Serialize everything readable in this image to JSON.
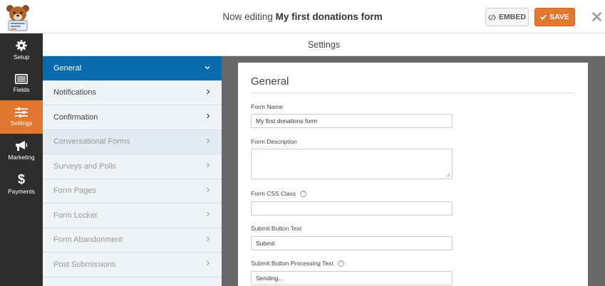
{
  "header": {
    "title_prefix": "Now editing",
    "form_name": "My first donations form",
    "embed_label": "EMBED",
    "save_label": "SAVE",
    "logo_icon": "wpforms-bear-logo-icon",
    "close_icon": "close-icon"
  },
  "sidebar": {
    "items": [
      {
        "label": "Setup",
        "icon": "gear-icon",
        "active": false
      },
      {
        "label": "Fields",
        "icon": "fields-list-icon",
        "active": false
      },
      {
        "label": "Settings",
        "icon": "sliders-icon",
        "active": true
      },
      {
        "label": "Marketing",
        "icon": "megaphone-icon",
        "active": false
      },
      {
        "label": "Payments",
        "icon": "dollar-icon",
        "active": false
      }
    ]
  },
  "subheader": {
    "title": "Settings"
  },
  "panels": {
    "items": [
      {
        "label": "General",
        "active": true,
        "enabled": true
      },
      {
        "label": "Notifications",
        "active": false,
        "enabled": true
      },
      {
        "label": "Confirmation",
        "active": false,
        "enabled": true
      },
      {
        "label": "Conversational Forms",
        "active": false,
        "enabled": false
      },
      {
        "label": "Surveys and Polls",
        "active": false,
        "enabled": false
      },
      {
        "label": "Form Pages",
        "active": false,
        "enabled": false
      },
      {
        "label": "Form Locker",
        "active": false,
        "enabled": false
      },
      {
        "label": "Form Abandonment",
        "active": false,
        "enabled": false
      },
      {
        "label": "Post Submissions",
        "active": false,
        "enabled": false
      }
    ]
  },
  "general": {
    "title": "General",
    "form_name_label": "Form Name",
    "form_name_value": "My first donations form",
    "form_description_label": "Form Description",
    "form_description_value": "",
    "css_class_label": "Form CSS Class",
    "css_class_value": "",
    "submit_text_label": "Submit Button Text",
    "submit_text_value": "Submit",
    "processing_text_label": "Submit Button Processing Text",
    "processing_text_value": "Sending..."
  },
  "colors": {
    "accent_orange": "#e27730",
    "active_blue": "#0a6aae",
    "sidebar_dark": "#2d2d2d",
    "panel_bg": "#eef3f7",
    "content_gray": "#686868"
  }
}
